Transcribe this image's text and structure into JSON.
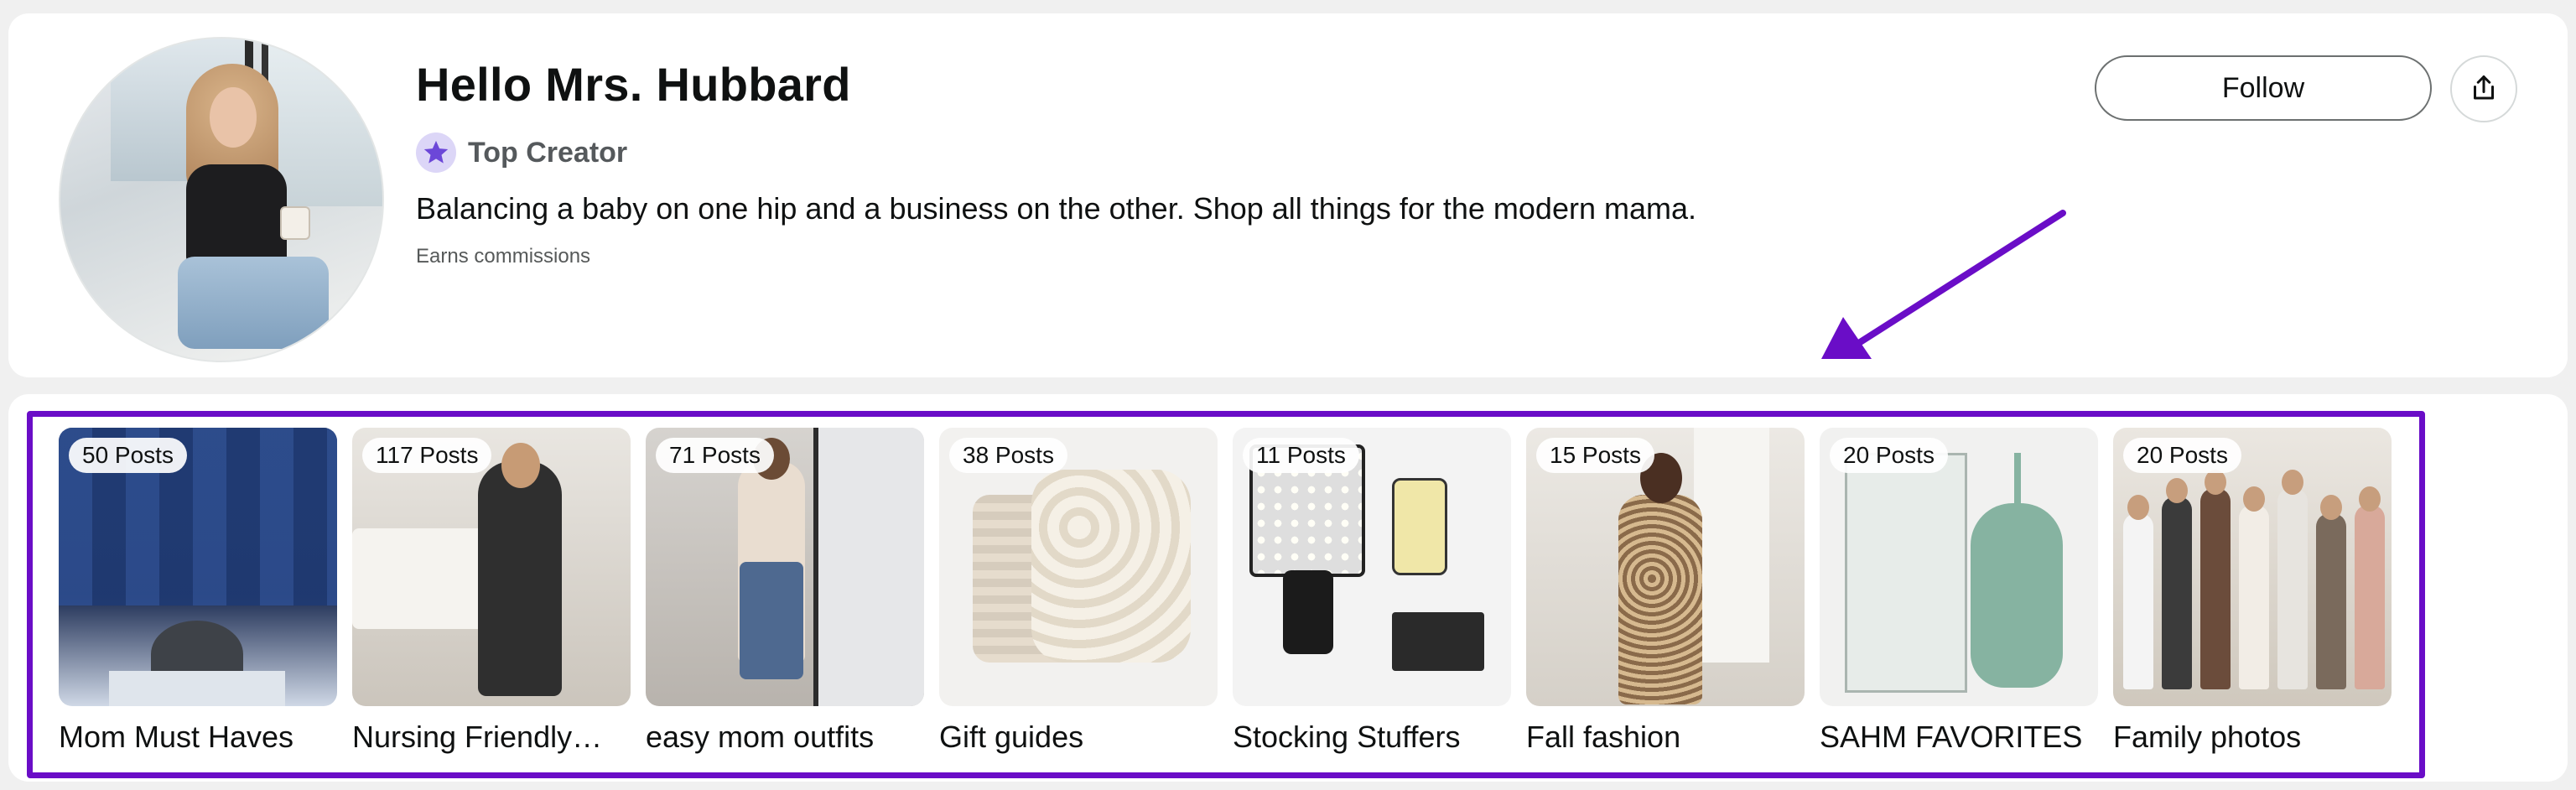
{
  "profile": {
    "name": "Hello Mrs. Hubbard",
    "badge_label": "Top Creator",
    "bio": "Balancing a baby on one hip and a business on the other. Shop all things for the modern mama.",
    "commission_note": "Earns commissions",
    "follow_label": "Follow",
    "share_icon": "share-icon"
  },
  "colors": {
    "highlight": "#6a0dc7",
    "badge_star": "#6c47d8",
    "badge_bg": "#dcd6f7"
  },
  "collections": [
    {
      "posts": "50 Posts",
      "title": "Mom Must Haves"
    },
    {
      "posts": "117 Posts",
      "title": "Nursing Friendly…"
    },
    {
      "posts": "71 Posts",
      "title": "easy mom outfits"
    },
    {
      "posts": "38 Posts",
      "title": "Gift guides"
    },
    {
      "posts": "11 Posts",
      "title": "Stocking Stuffers"
    },
    {
      "posts": "15 Posts",
      "title": "Fall fashion"
    },
    {
      "posts": "20 Posts",
      "title": "SAHM FAVORITES"
    },
    {
      "posts": "20 Posts",
      "title": "Family photos"
    }
  ]
}
